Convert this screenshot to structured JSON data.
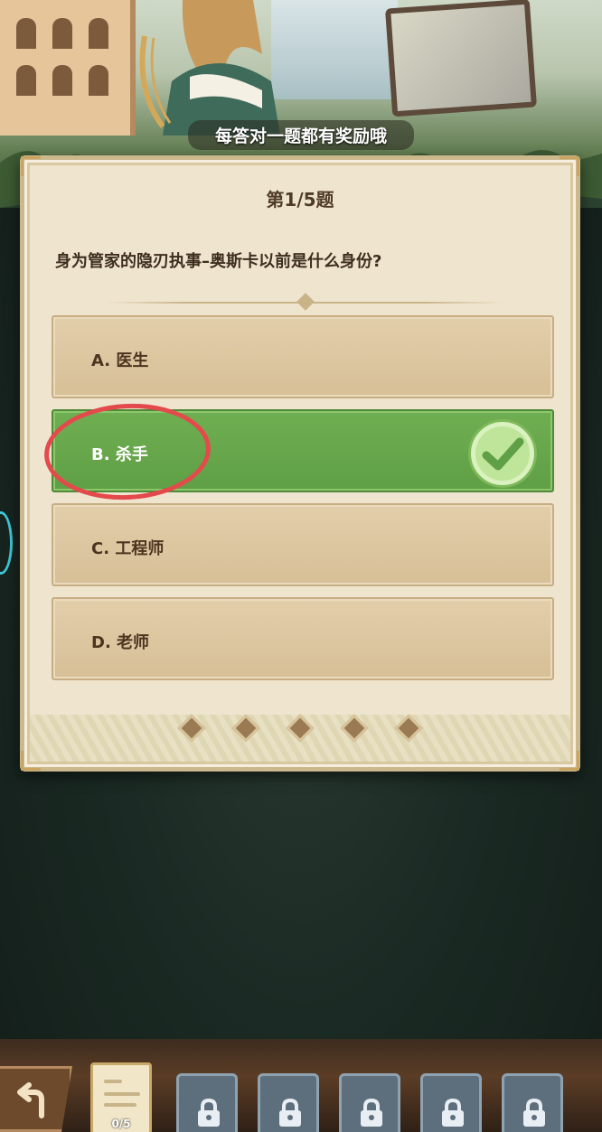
{
  "top_banner": {
    "text": "每答对一题都有奖励哦"
  },
  "quiz": {
    "progress_title": "第1/5题",
    "question": "身为管家的隐刃执事–奥斯卡以前是什么身份?",
    "options": [
      {
        "label": "A. 医生",
        "state": "default"
      },
      {
        "label": "B. 杀手",
        "state": "correct"
      },
      {
        "label": "C. 工程师",
        "state": "default"
      },
      {
        "label": "D. 老师",
        "state": "default"
      }
    ],
    "page_dots": 5
  },
  "bottom_bar": {
    "paper_count": "0/5",
    "locked_slots": 5
  },
  "colors": {
    "correct_green": "#64a64a",
    "card_bg": "#efe5cf",
    "option_bg": "#dcc6a0",
    "annotation_red": "#e4494c"
  }
}
